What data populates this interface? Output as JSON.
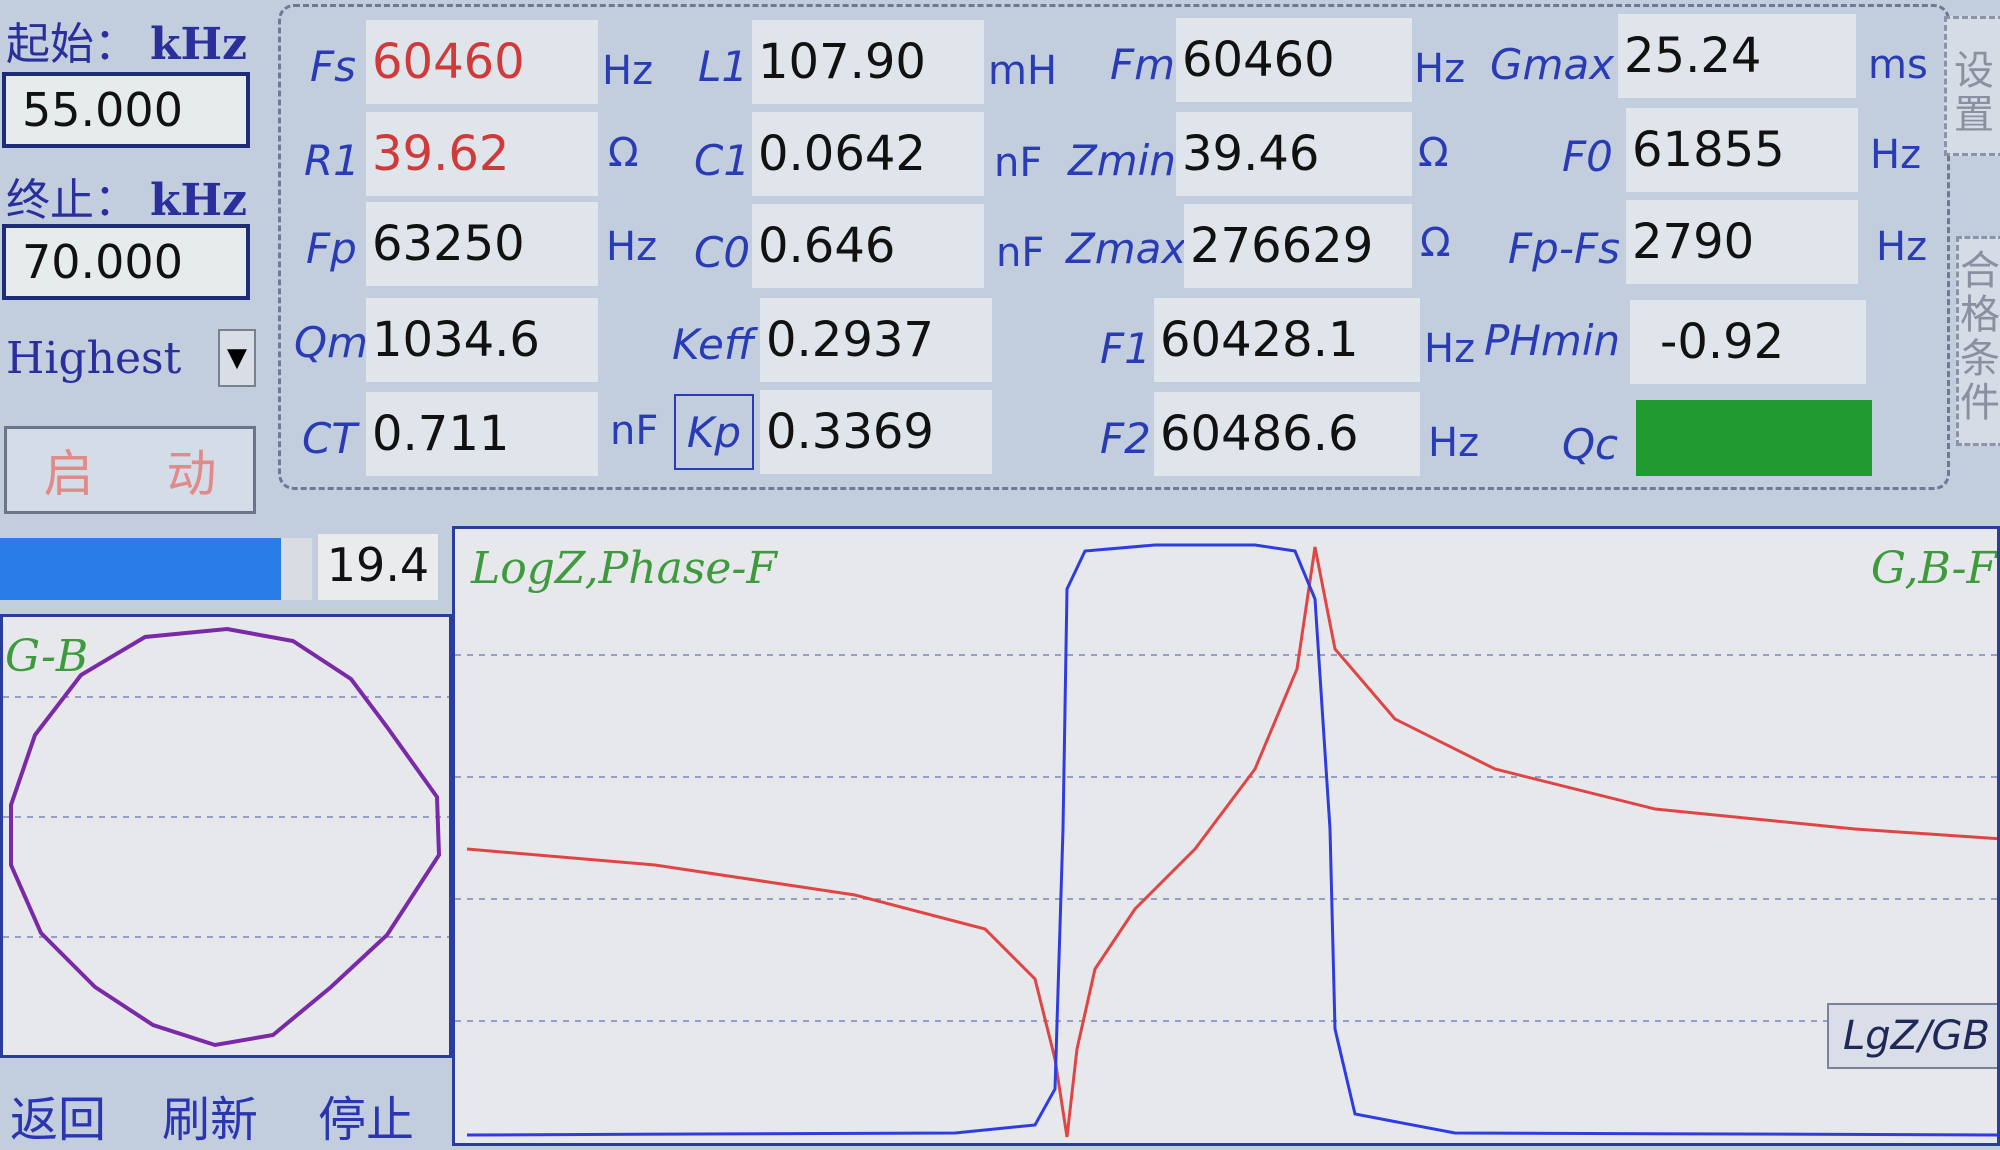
{
  "sweep": {
    "start_label": "起始：",
    "start_unit": "kHz",
    "start_value": "55.000",
    "stop_label": "终止：",
    "stop_unit": "kHz",
    "stop_value": "70.000",
    "precision_value": "Highest",
    "start_button": [
      "启",
      "动"
    ]
  },
  "params": {
    "Fs": {
      "label": "Fs",
      "value": "60460",
      "unit": "Hz"
    },
    "R1": {
      "label": "R1",
      "value": "39.62",
      "unit": "Ω"
    },
    "Fp": {
      "label": "Fp",
      "value": "63250",
      "unit": "Hz"
    },
    "Qm": {
      "label": "Qm",
      "value": "1034.6",
      "unit": ""
    },
    "CT": {
      "label": "CT",
      "value": "0.711",
      "unit": "nF"
    },
    "L1": {
      "label": "L1",
      "value": "107.90",
      "unit": "mH"
    },
    "C1": {
      "label": "C1",
      "value": "0.0642",
      "unit": "nF"
    },
    "C0": {
      "label": "C0",
      "value": "0.646",
      "unit": "nF"
    },
    "Keff": {
      "label": "Keff",
      "value": "0.2937",
      "unit": ""
    },
    "Kp": {
      "label": "Kp",
      "value": "0.3369",
      "unit": ""
    },
    "Fm": {
      "label": "Fm",
      "value": "60460",
      "unit": "Hz"
    },
    "Zmin": {
      "label": "Zmin",
      "value": "39.46",
      "unit": "Ω"
    },
    "Zmax": {
      "label": "Zmax",
      "value": "276629",
      "unit": "Ω"
    },
    "F1": {
      "label": "F1",
      "value": "60428.1",
      "unit": "Hz"
    },
    "F2": {
      "label": "F2",
      "value": "60486.6",
      "unit": "Hz"
    },
    "Gmax": {
      "label": "Gmax",
      "value": "25.24",
      "unit": "ms"
    },
    "F0": {
      "label": "F0",
      "value": "61855",
      "unit": "Hz"
    },
    "FpFs": {
      "label": "Fp-Fs",
      "value": "2790",
      "unit": "Hz"
    },
    "PHmin": {
      "label": "PHmin",
      "value": "-0.92",
      "unit": ""
    },
    "Qc": {
      "label": "Qc",
      "status_color": "#1f9a2e"
    }
  },
  "side_buttons": {
    "settings": [
      "设",
      "置"
    ],
    "pass_condition": [
      "合",
      "格",
      "条",
      "件"
    ]
  },
  "progress": {
    "value": "19.4",
    "fraction": 0.9
  },
  "gb_plot": {
    "title": "G-B"
  },
  "main_plot": {
    "title": "LogZ,Phase-F",
    "right_title": "G,B-F",
    "mode_button": "LgZ/GB",
    "colors": {
      "impedance": "#e04545",
      "phase": "#2f3ce0",
      "grid": "#7a86b8"
    }
  },
  "nav": {
    "back": "返回",
    "refresh": "刷新",
    "stop": "停止"
  }
}
